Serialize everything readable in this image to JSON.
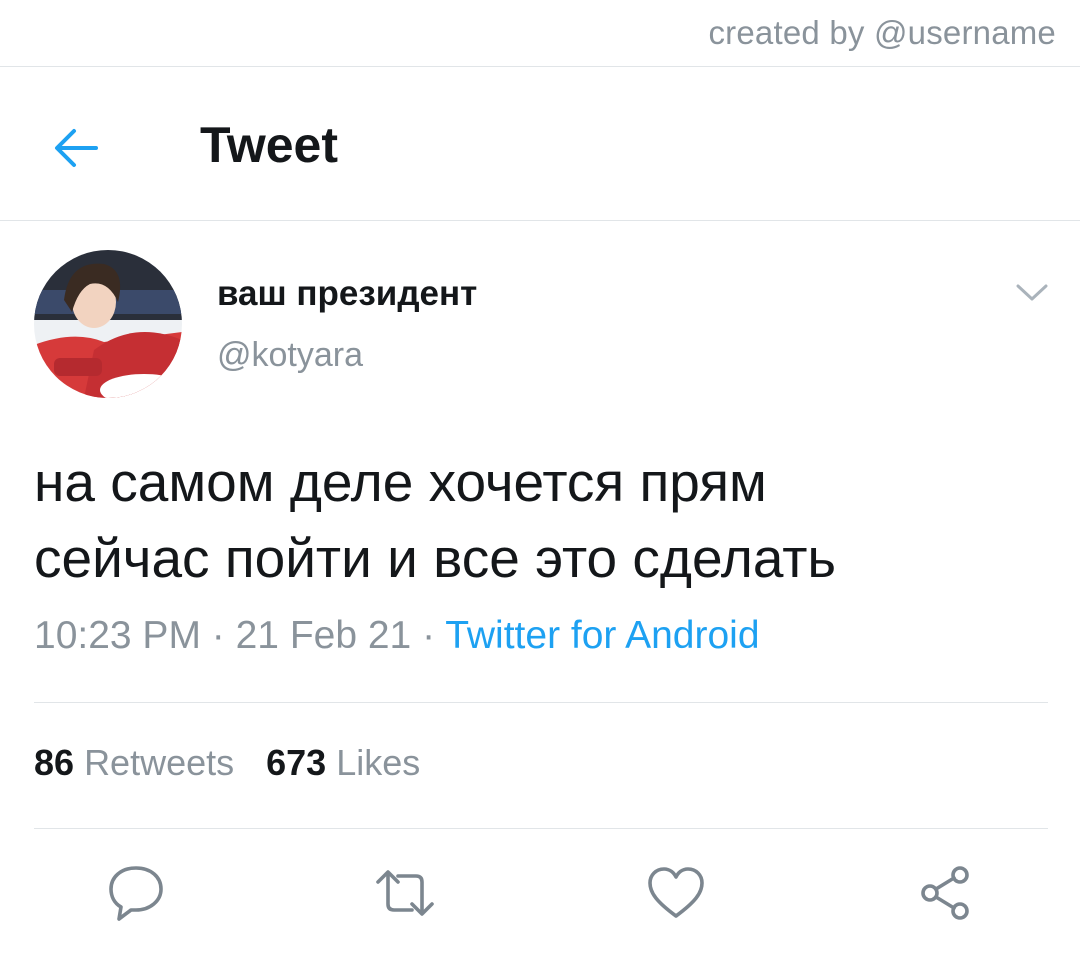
{
  "watermark": "created by @username",
  "header": {
    "back_icon": "arrow-left-icon",
    "title": "Tweet"
  },
  "author": {
    "display_name": "ваш президент",
    "handle": "@kotyara",
    "menu_icon": "chevron-down-icon"
  },
  "tweet": {
    "text_lines": [
      "на самом деле хочется прям",
      "сейчас пойти и все это сделать"
    ],
    "time": "10:23 PM",
    "separator": " · ",
    "date": "21 Feb 21",
    "source": "Twitter for Android"
  },
  "stats": {
    "retweets_count": "86",
    "retweets_label": "Retweets",
    "likes_count": "673",
    "likes_label": "Likes"
  },
  "actions": [
    {
      "icon": "reply-icon"
    },
    {
      "icon": "retweet-icon"
    },
    {
      "icon": "heart-icon"
    },
    {
      "icon": "share-icon"
    }
  ],
  "colors": {
    "accent": "#1da1f2",
    "muted": "#8a939b",
    "text": "#14171a",
    "divider": "#e1e5e8"
  }
}
